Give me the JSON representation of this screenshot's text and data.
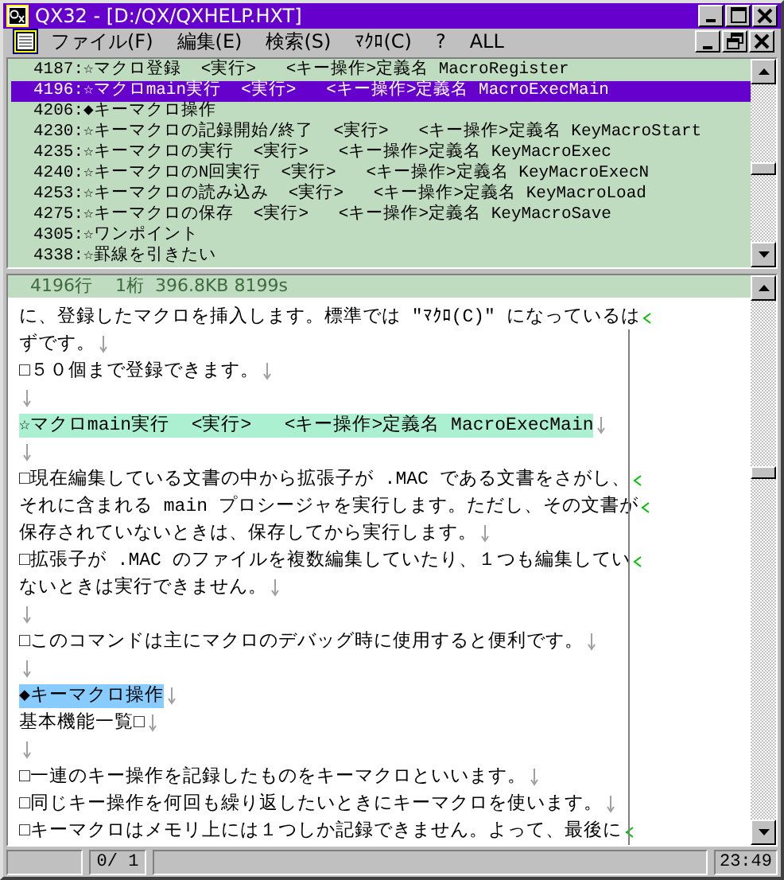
{
  "window": {
    "title": "QX32 - [D:/QX/QXHELP.HXT]"
  },
  "menu": [
    "ファイル(F)",
    "編集(E)",
    "検索(S)",
    "ﾏｸﾛ(C)",
    "?",
    "ALL"
  ],
  "outline": {
    "items": [
      {
        "text": "4187:☆マクロ登録  <実行>   <キー操作>定義名 MacroRegister",
        "selected": false
      },
      {
        "text": "4196:☆マクロmain実行  <実行>   <キー操作>定義名 MacroExecMain",
        "selected": true
      },
      {
        "text": "4206:◆キーマクロ操作",
        "selected": false
      },
      {
        "text": "4230:☆キーマクロの記録開始/終了  <実行>   <キー操作>定義名 KeyMacroStart",
        "selected": false
      },
      {
        "text": "4235:☆キーマクロの実行  <実行>   <キー操作>定義名 KeyMacroExec",
        "selected": false
      },
      {
        "text": "4240:☆キーマクロのN回実行  <実行>   <キー操作>定義名 KeyMacroExecN",
        "selected": false
      },
      {
        "text": "4253:☆キーマクロの読み込み  <実行>   <キー操作>定義名 KeyMacroLoad",
        "selected": false
      },
      {
        "text": "4275:☆キーマクロの保存  <実行>   <キー操作>定義名 KeyMacroSave",
        "selected": false
      },
      {
        "text": "4305:☆ワンポイント",
        "selected": false
      },
      {
        "text": "4338:☆罫線を引きたい",
        "selected": false
      }
    ]
  },
  "editor": {
    "status": "4196行　 1桁  396.8KB 8199s",
    "lines": [
      {
        "kind": "plain",
        "text": "に、登録したマクロを挿入します。標準では ″ﾏｸﾛ(C)″ になっているは",
        "wrapped": true
      },
      {
        "kind": "plain",
        "text": "ずです。",
        "wrapped": false
      },
      {
        "kind": "plain",
        "text": "□５０個まで登録できます。",
        "wrapped": false
      },
      {
        "kind": "blank",
        "wrapped": false
      },
      {
        "kind": "found",
        "text": "☆マクロmain実行  <実行>   <キー操作>定義名 MacroExecMain",
        "wrapped": false
      },
      {
        "kind": "blank",
        "wrapped": false
      },
      {
        "kind": "plain",
        "text": "□現在編集している文書の中から拡張子が .MAC である文書をさがし、",
        "wrapped": true
      },
      {
        "kind": "plain",
        "text": "それに含まれる main プロシージャを実行します。ただし、その文書が",
        "wrapped": true
      },
      {
        "kind": "plain",
        "text": "保存されていないときは、保存してから実行します。",
        "wrapped": false
      },
      {
        "kind": "plain",
        "text": "□拡張子が .MAC のファイルを複数編集していたり、１つも編集してい",
        "wrapped": true
      },
      {
        "kind": "plain",
        "text": "ないときは実行できません。",
        "wrapped": false
      },
      {
        "kind": "blank",
        "wrapped": false
      },
      {
        "kind": "plain",
        "text": "□このコマンドは主にマクロのデバッグ時に使用すると便利です。",
        "wrapped": false
      },
      {
        "kind": "blank",
        "wrapped": false
      },
      {
        "kind": "cursor",
        "text": "◆キーマクロ操作",
        "wrapped": false
      },
      {
        "kind": "plain",
        "text": "基本機能一覧□",
        "wrapped": false
      },
      {
        "kind": "blank",
        "wrapped": false
      },
      {
        "kind": "plain",
        "text": "□一連のキー操作を記録したものをキーマクロといいます。",
        "wrapped": false
      },
      {
        "kind": "plain",
        "text": "□同じキー操作を何回も繰り返したいときにキーマクロを使います。",
        "wrapped": false
      },
      {
        "kind": "plain",
        "text": "□キーマクロはメモリ上には１つしか記録できません。よって、最後に",
        "wrapped": true
      }
    ]
  },
  "status_bar": {
    "position": "0/ 1",
    "clock": "23:49"
  }
}
